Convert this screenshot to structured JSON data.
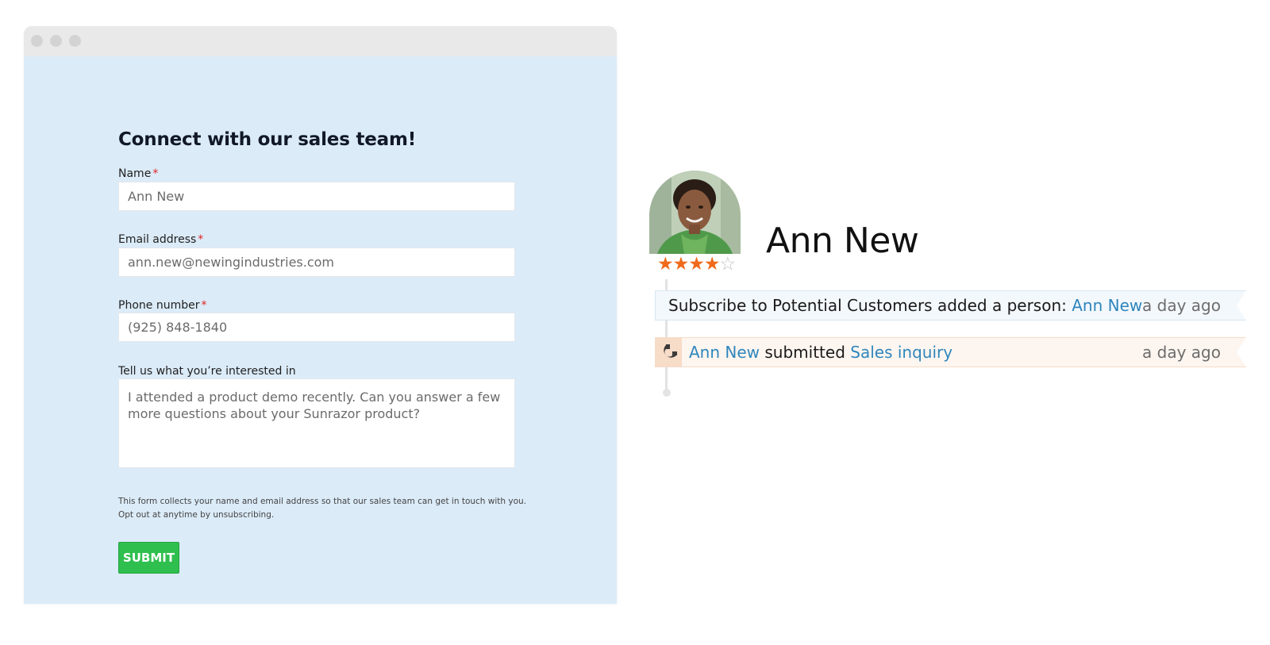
{
  "form": {
    "title": "Connect with our sales team!",
    "required_marker": "*",
    "fields": {
      "name": {
        "label": "Name",
        "value": "Ann New"
      },
      "email": {
        "label": "Email address",
        "value": "ann.new@newingindustries.com"
      },
      "phone": {
        "label": "Phone number",
        "value": "(925) 848-1840"
      },
      "interest": {
        "label": "Tell us what you’re interested in",
        "value": "I attended a product demo recently. Can you answer a few more questions about your Sunrazor product?"
      }
    },
    "disclaimer_line1": "This form collects your name and email address so that our sales team can get in touch with you.",
    "disclaimer_line2": "Opt out at anytime by unsubscribing.",
    "submit_label": "SUBMIT"
  },
  "person": {
    "name": "Ann New",
    "rating": 4,
    "rating_max": 5,
    "star_glyph_on": "★",
    "star_glyph_off": "☆"
  },
  "activity": [
    {
      "prefix": "Subscribe to Potential Customers added a person: ",
      "link": "Ann New",
      "time": "a day ago",
      "accent": "#d8e7f3"
    },
    {
      "icon": "magnet-icon",
      "link1": "Ann New",
      "middle": " submitted ",
      "link2": "Sales inquiry",
      "time": "a day ago",
      "accent": "#f6dcc8"
    }
  ],
  "colors": {
    "form_background": "#dbebf8",
    "submit_green": "#2fbf4e",
    "required_red": "#e02424",
    "link_blue": "#2f86bd",
    "star_orange": "#f06a1c"
  }
}
